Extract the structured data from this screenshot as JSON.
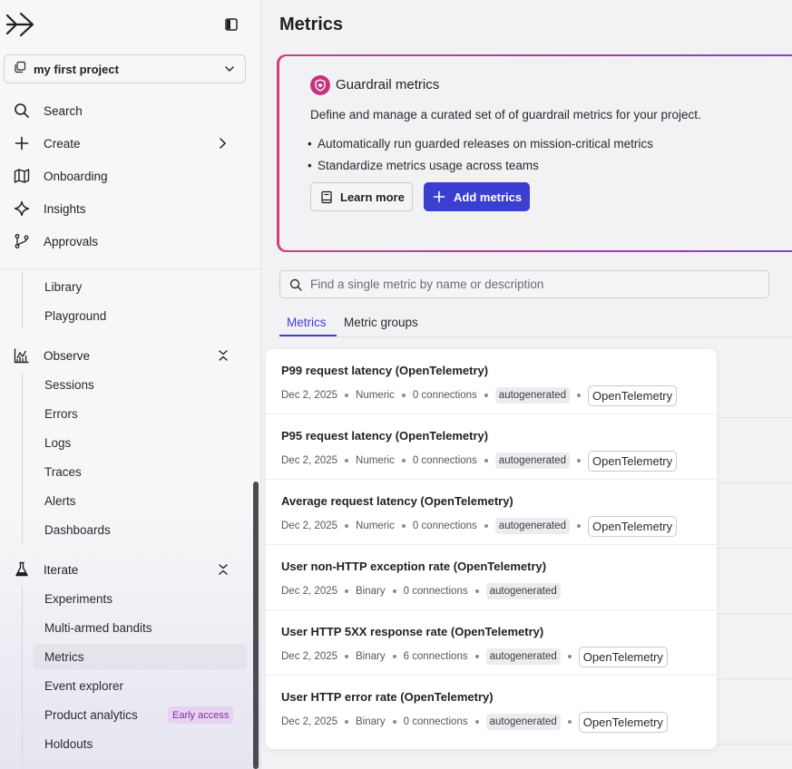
{
  "sidebar": {
    "project": "my first project",
    "nav": [
      {
        "label": "Search",
        "icon": "search-icon"
      },
      {
        "label": "Create",
        "icon": "plus-icon"
      },
      {
        "label": "Onboarding",
        "icon": "map-icon"
      },
      {
        "label": "Insights",
        "icon": "sparkle-icon"
      },
      {
        "label": "Approvals",
        "icon": "branch-icon"
      }
    ],
    "sub_top": [
      "Library",
      "Playground"
    ],
    "observe": {
      "label": "Observe",
      "items": [
        "Sessions",
        "Errors",
        "Logs",
        "Traces",
        "Alerts",
        "Dashboards"
      ]
    },
    "iterate": {
      "label": "Iterate",
      "items": [
        "Experiments",
        "Multi-armed bandits",
        "Metrics",
        "Event explorer",
        "Product analytics",
        "Holdouts"
      ],
      "active": "Metrics",
      "badge": "Early access"
    }
  },
  "main": {
    "title": "Metrics",
    "guardrail": {
      "title": "Guardrail metrics",
      "description": "Define and manage a curated set of of guardrail metrics for your project.",
      "bullets": [
        "Automatically run guarded releases on mission-critical metrics",
        "Standardize metrics usage across teams"
      ],
      "learn_more": "Learn more",
      "add_metrics": "Add metrics"
    },
    "search": {
      "placeholder": "Find a single metric by name or description"
    },
    "tabs": [
      "Metrics",
      "Metric groups"
    ]
  },
  "metrics": [
    {
      "name": "P99 request latency (OpenTelemetry)",
      "date": "Dec 2, 2025",
      "kind": "Numeric",
      "connections": "0 connections",
      "tag": "autogenerated",
      "source": "OpenTelemetry"
    },
    {
      "name": "P95 request latency (OpenTelemetry)",
      "date": "Dec 2, 2025",
      "kind": "Numeric",
      "connections": "0 connections",
      "tag": "autogenerated",
      "source": "OpenTelemetry"
    },
    {
      "name": "Average request latency (OpenTelemetry)",
      "date": "Dec 2, 2025",
      "kind": "Numeric",
      "connections": "0 connections",
      "tag": "autogenerated",
      "source": "OpenTelemetry"
    },
    {
      "name": "User non-HTTP exception rate (OpenTelemetry)",
      "date": "Dec 2, 2025",
      "kind": "Binary",
      "connections": "0 connections",
      "tag": "autogenerated",
      "source": ""
    },
    {
      "name": "User HTTP 5XX response rate (OpenTelemetry)",
      "date": "Dec 2, 2025",
      "kind": "Binary",
      "connections": "6 connections",
      "tag": "autogenerated",
      "source": "OpenTelemetry"
    },
    {
      "name": "User HTTP error rate (OpenTelemetry)",
      "date": "Dec 2, 2025",
      "kind": "Binary",
      "connections": "0 connections",
      "tag": "autogenerated",
      "source": "OpenTelemetry"
    }
  ],
  "colors": {
    "accent": "#3b3fd0",
    "guardrail_pink": "#cf3d83",
    "badge_purple": "#7c2f9f"
  }
}
